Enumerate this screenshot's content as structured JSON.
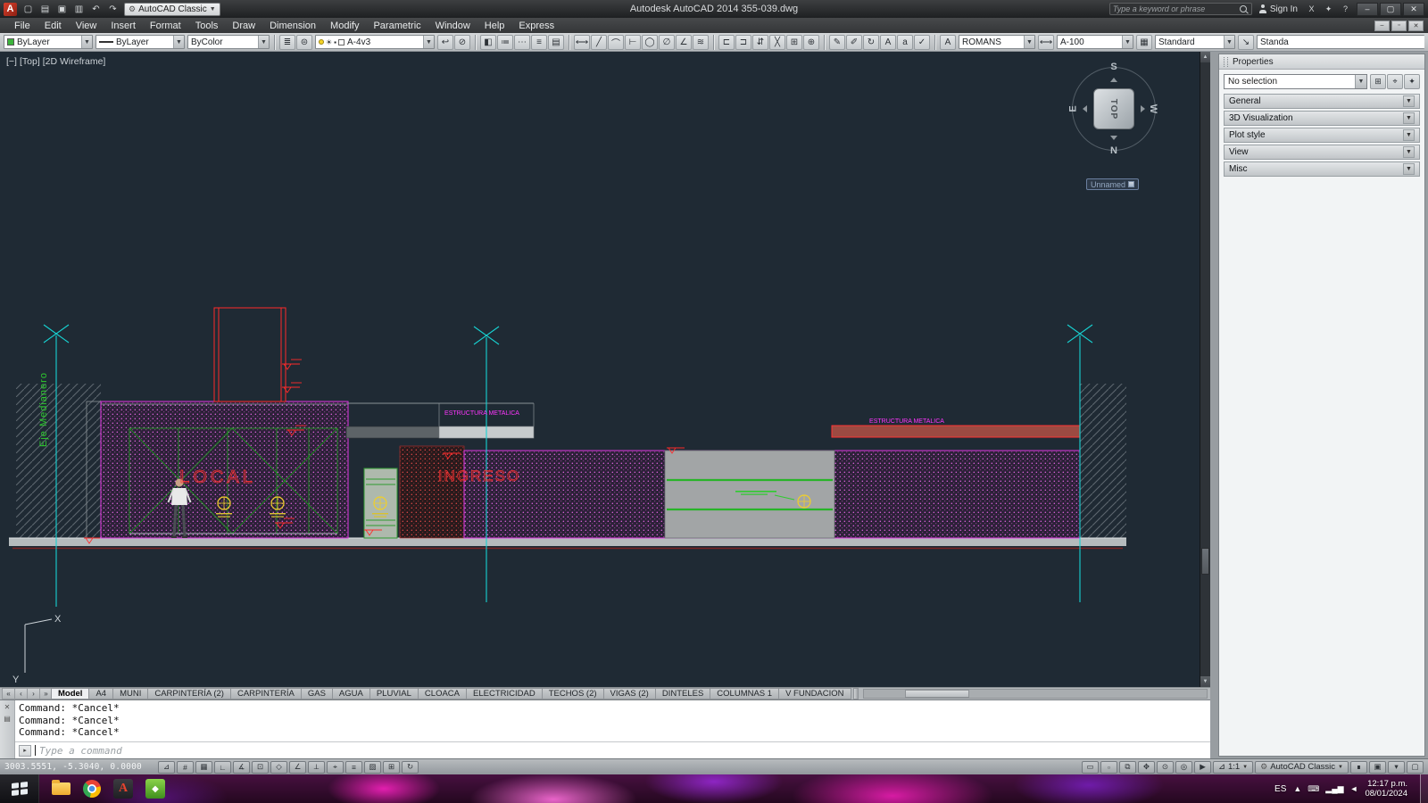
{
  "titlebar": {
    "title": "Autodesk AutoCAD 2014   355-039.dwg",
    "workspace": "AutoCAD Classic",
    "search_placeholder": "Type a keyword or phrase",
    "sign_in": "Sign In",
    "qat_icons": [
      {
        "name": "new-button",
        "glyph": "▢"
      },
      {
        "name": "open-button",
        "glyph": "▤"
      },
      {
        "name": "save-button",
        "glyph": "▣"
      },
      {
        "name": "plot-button",
        "glyph": "▥"
      },
      {
        "name": "undo-button",
        "glyph": "↶"
      },
      {
        "name": "redo-button",
        "glyph": "↷"
      }
    ],
    "right_icons": [
      {
        "name": "exchange-apps-icon",
        "glyph": "X"
      },
      {
        "name": "stay-connected-icon",
        "glyph": "✦"
      },
      {
        "name": "help-icon",
        "glyph": "?"
      }
    ],
    "window_buttons": [
      {
        "name": "minimize-button",
        "glyph": "–"
      },
      {
        "name": "restore-button",
        "glyph": "▢"
      },
      {
        "name": "close-button",
        "glyph": "✕"
      }
    ]
  },
  "menubar": {
    "items": [
      "File",
      "Edit",
      "View",
      "Insert",
      "Format",
      "Tools",
      "Draw",
      "Dimension",
      "Modify",
      "Parametric",
      "Window",
      "Help",
      "Express"
    ],
    "window_buttons": [
      {
        "name": "child-minimize-button",
        "glyph": "‒"
      },
      {
        "name": "child-restore-button",
        "glyph": "▫"
      },
      {
        "name": "child-close-button",
        "glyph": "✕"
      }
    ]
  },
  "toolbar": {
    "color": "ByLayer",
    "linetype": "ByLayer",
    "plot_style": "ByColor",
    "layer": "A-4v3",
    "text_style": "ROMANS",
    "dim_style": "A-100",
    "table_style": "Standard",
    "mleader_style": "Standa",
    "group_layer": [
      {
        "name": "layer-properties-button",
        "glyph": "≣"
      },
      {
        "name": "layer-states-button",
        "glyph": "⊜"
      }
    ],
    "group_layer2": [
      {
        "name": "layer-previous-button",
        "glyph": "↩"
      },
      {
        "name": "layer-isolate-button",
        "glyph": "⊘"
      }
    ],
    "group_properties": [
      {
        "name": "match-properties-button",
        "glyph": "◧"
      },
      {
        "name": "set-bylayer-button",
        "glyph": "≔"
      },
      {
        "name": "linetype-manager-button",
        "glyph": "⋯"
      },
      {
        "name": "lineweight-settings-button",
        "glyph": "≡"
      },
      {
        "name": "plot-style-manager-button",
        "glyph": "▤"
      }
    ],
    "group_dimension": [
      {
        "name": "linear-dimension-button",
        "glyph": "⟷"
      },
      {
        "name": "aligned-dimension-button",
        "glyph": "╱"
      },
      {
        "name": "arc-length-dimension-button",
        "glyph": "⌒"
      },
      {
        "name": "ordinate-dimension-button",
        "glyph": "⊢"
      },
      {
        "name": "radius-dimension-button",
        "glyph": "◯"
      },
      {
        "name": "diameter-dimension-button",
        "glyph": "∅"
      },
      {
        "name": "angular-dimension-button",
        "glyph": "∠"
      },
      {
        "name": "quick-dimension-button",
        "glyph": "≋"
      }
    ],
    "group_dimension2": [
      {
        "name": "baseline-dimension-button",
        "glyph": "⊏"
      },
      {
        "name": "continue-dimension-button",
        "glyph": "⊐"
      },
      {
        "name": "dimension-space-button",
        "glyph": "⇵"
      },
      {
        "name": "dimension-break-button",
        "glyph": "╳"
      },
      {
        "name": "tolerance-button",
        "glyph": "⊞"
      },
      {
        "name": "center-mark-button",
        "glyph": "⊕"
      }
    ],
    "group_text": [
      {
        "name": "dimension-edit-button",
        "glyph": "✎"
      },
      {
        "name": "dimension-text-edit-button",
        "glyph": "✐"
      },
      {
        "name": "dimension-update-button",
        "glyph": "↻"
      },
      {
        "name": "multiline-text-button",
        "glyph": "A"
      },
      {
        "name": "single-line-text-button",
        "glyph": "a"
      },
      {
        "name": "spell-check-button",
        "glyph": "✓"
      }
    ]
  },
  "viewport": {
    "controls": [
      {
        "name": "viewport-minimize-control",
        "label": "[−]"
      },
      {
        "name": "viewport-view-control",
        "label": "[Top]"
      },
      {
        "name": "viewport-visual-style-control",
        "label": "[2D Wireframe]"
      }
    ],
    "viewcube": {
      "face": "TOP",
      "n": "N",
      "s": "S",
      "e": "E",
      "w": "W"
    },
    "badge": "Unnamed"
  },
  "drawing": {
    "labels": {
      "local": "LOCAL",
      "ingreso": "INGRESO",
      "estructura_left": "ESTRUCTURA METALICA",
      "estructura_right": "ESTRUCTURA METALICA",
      "eje": "Eje Medianero"
    },
    "ucs": {
      "x": "X",
      "y": "Y"
    }
  },
  "tabs": {
    "nav": [
      {
        "name": "tab-scroll-first-button",
        "glyph": "«"
      },
      {
        "name": "tab-scroll-prev-button",
        "glyph": "‹"
      },
      {
        "name": "tab-scroll-next-button",
        "glyph": "›"
      },
      {
        "name": "tab-scroll-last-button",
        "glyph": "»"
      }
    ],
    "items": [
      {
        "label": "Model",
        "active": true
      },
      {
        "label": "A4"
      },
      {
        "label": "MUNI"
      },
      {
        "label": "CARPINTERÍA (2)"
      },
      {
        "label": "CARPINTERÍA"
      },
      {
        "label": "GAS"
      },
      {
        "label": "AGUA"
      },
      {
        "label": "PLUVIAL"
      },
      {
        "label": "CLOACA"
      },
      {
        "label": "ELECTRICIDAD"
      },
      {
        "label": "TECHOS (2)"
      },
      {
        "label": "VIGAS (2)"
      },
      {
        "label": "DINTELES"
      },
      {
        "label": "COLUMNAS 1"
      },
      {
        "label": "V FUNDACION"
      }
    ]
  },
  "command": {
    "history": [
      "Command: *Cancel*",
      "Command: *Cancel*",
      "Command: *Cancel*"
    ],
    "prompt": "Type a command"
  },
  "statusbar": {
    "coordinates": "3003.5551, -5.3040, 0.0000",
    "toggles": [
      {
        "name": "infer-constraints-toggle",
        "glyph": "⊿"
      },
      {
        "name": "snap-mode-toggle",
        "glyph": "#"
      },
      {
        "name": "grid-display-toggle",
        "glyph": "▦"
      },
      {
        "name": "ortho-mode-toggle",
        "glyph": "∟"
      },
      {
        "name": "polar-tracking-toggle",
        "glyph": "∡"
      },
      {
        "name": "object-snap-toggle",
        "glyph": "⊡"
      },
      {
        "name": "3d-object-snap-toggle",
        "glyph": "◇"
      },
      {
        "name": "object-snap-tracking-toggle",
        "glyph": "∠"
      },
      {
        "name": "dynamic-ucs-toggle",
        "glyph": "⟂"
      },
      {
        "name": "dynamic-input-toggle",
        "glyph": "⌖"
      },
      {
        "name": "lineweight-display-toggle",
        "glyph": "≡"
      },
      {
        "name": "transparency-toggle",
        "glyph": "▨"
      },
      {
        "name": "quick-properties-toggle",
        "glyph": "⊞"
      },
      {
        "name": "selection-cycling-toggle",
        "glyph": "↻"
      }
    ],
    "right_icons": [
      {
        "name": "model-space-button",
        "glyph": "▭"
      },
      {
        "name": "quick-view-layouts-button",
        "glyph": "▫"
      },
      {
        "name": "quick-view-drawings-button",
        "glyph": "⧉"
      },
      {
        "name": "pan-button",
        "glyph": "✥"
      },
      {
        "name": "zoom-button",
        "glyph": "⊙"
      },
      {
        "name": "steering-wheel-button",
        "glyph": "◎"
      },
      {
        "name": "show-motion-button",
        "glyph": "▶"
      }
    ],
    "annotation_scale": "1:1",
    "workspace": "AutoCAD Classic",
    "far_icons": [
      {
        "name": "workspace-lock-button",
        "glyph": "∎"
      },
      {
        "name": "hardware-acceleration-button",
        "glyph": "▣"
      },
      {
        "name": "status-menu-button",
        "glyph": "▾"
      },
      {
        "name": "clean-screen-button",
        "glyph": "▢"
      }
    ]
  },
  "properties_panel": {
    "title": "Properties",
    "selection": "No selection",
    "tool_icons": [
      {
        "name": "pickadd-toggle-button",
        "glyph": "⊞"
      },
      {
        "name": "select-objects-button",
        "glyph": "⌖"
      },
      {
        "name": "quick-select-button",
        "glyph": "✦"
      }
    ],
    "sections": [
      "General",
      "3D Visualization",
      "Plot style",
      "View",
      "Misc"
    ]
  },
  "taskbar": {
    "language": "ES",
    "time": "12:17 p.m.",
    "date": "08/01/2024",
    "tray_glyphs": [
      {
        "name": "hidden-icons-button",
        "glyph": "▲"
      },
      {
        "name": "keyboard-icon",
        "glyph": "⌨"
      },
      {
        "name": "network-icon",
        "glyph": "▂▄▆"
      },
      {
        "name": "volume-icon",
        "glyph": "◄"
      }
    ]
  }
}
